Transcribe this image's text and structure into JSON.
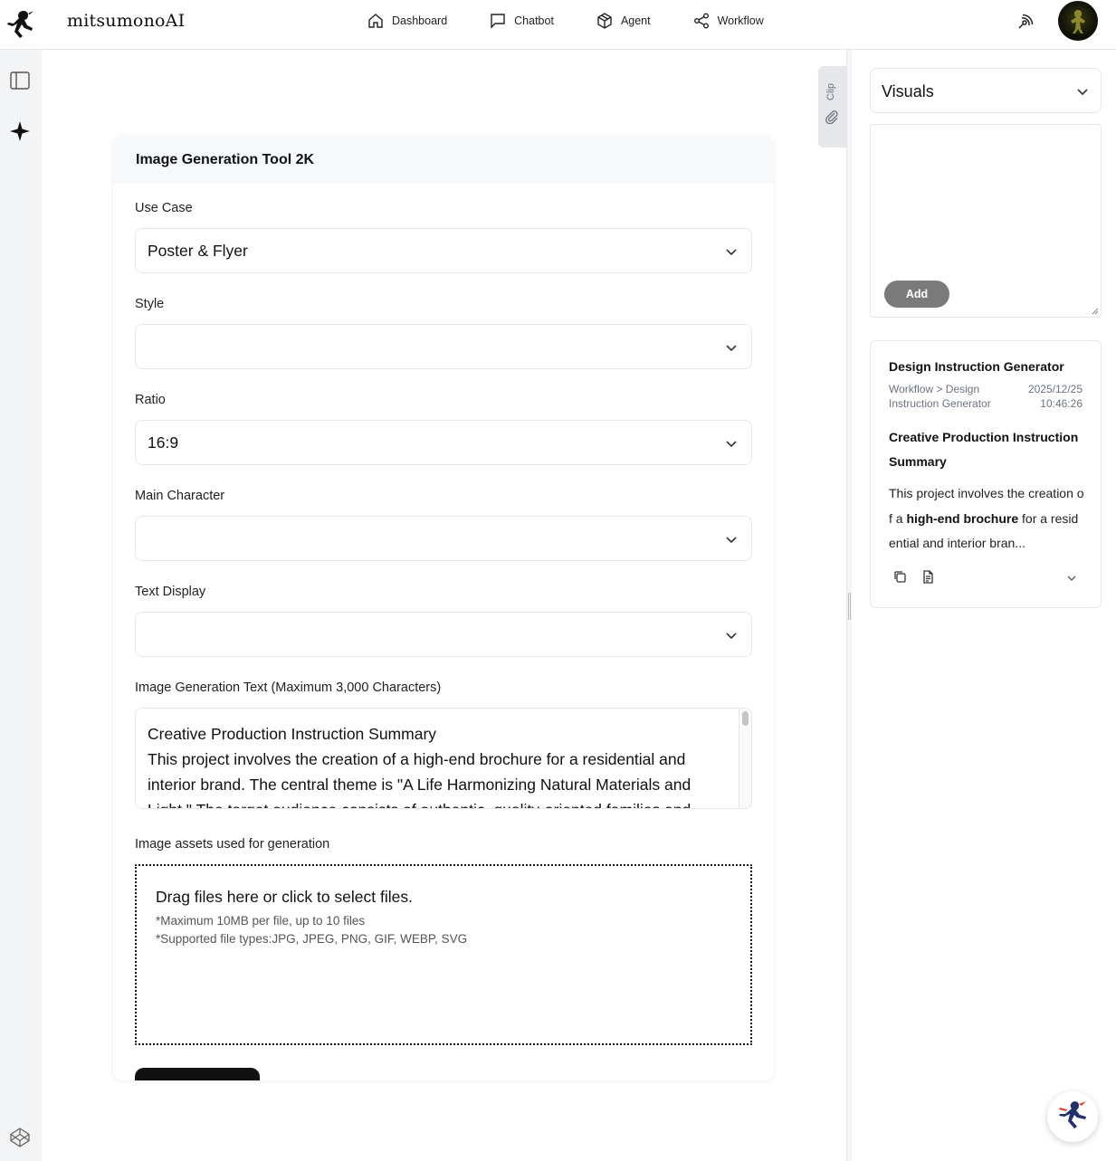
{
  "app": {
    "brand": "mitsumonoAI"
  },
  "nav": {
    "items": [
      {
        "label": "Dashboard",
        "icon": "home-icon"
      },
      {
        "label": "Chatbot",
        "icon": "chat-icon"
      },
      {
        "label": "Agent",
        "icon": "cube-icon"
      },
      {
        "label": "Workflow",
        "icon": "share-nodes-icon"
      }
    ]
  },
  "clip": {
    "label": "Clip"
  },
  "form": {
    "title": "Image Generation Tool 2K",
    "use_case": {
      "label": "Use Case",
      "value": "Poster & Flyer"
    },
    "style": {
      "label": "Style",
      "value": ""
    },
    "ratio": {
      "label": "Ratio",
      "value": "16:9"
    },
    "main_character": {
      "label": "Main Character",
      "value": ""
    },
    "text_display": {
      "label": "Text Display",
      "value": ""
    },
    "prompt": {
      "label": "Image Generation Text (Maximum 3,000 Characters)",
      "line1": "Creative Production Instruction Summary",
      "line2": "This project involves the creation of a high-end brochure for a residential and interior brand. The central theme is \"A Life Harmonizing Natural Materials and Light.\" The target audience consists of authentic, quality-oriented families and"
    },
    "assets": {
      "label": "Image assets used for generation",
      "drop_title": "Drag files here or click to select files.",
      "note_size": "*Maximum 10MB per file, up to 10 files",
      "note_types": "*Supported file types:JPG, JPEG, PNG, GIF, WEBP, SVG"
    }
  },
  "right_panel": {
    "select_value": "Visuals",
    "add_label": "Add",
    "result": {
      "title": "Design Instruction Generator",
      "path": "Workflow > Design Instruction Generator",
      "date": "2025/12/25",
      "time": "10:46:26",
      "heading": "Creative Production Instruction Summary",
      "body_pre": "This project involves the creation of a ",
      "body_bold": "high-end brochure",
      "body_post": " for a residential and interior bran..."
    }
  },
  "colors": {
    "accent": "#111111",
    "card_header_bg": "#f5f9fc",
    "rail_bg": "#f3f4f6",
    "add_button_bg": "#7a7a7a"
  }
}
